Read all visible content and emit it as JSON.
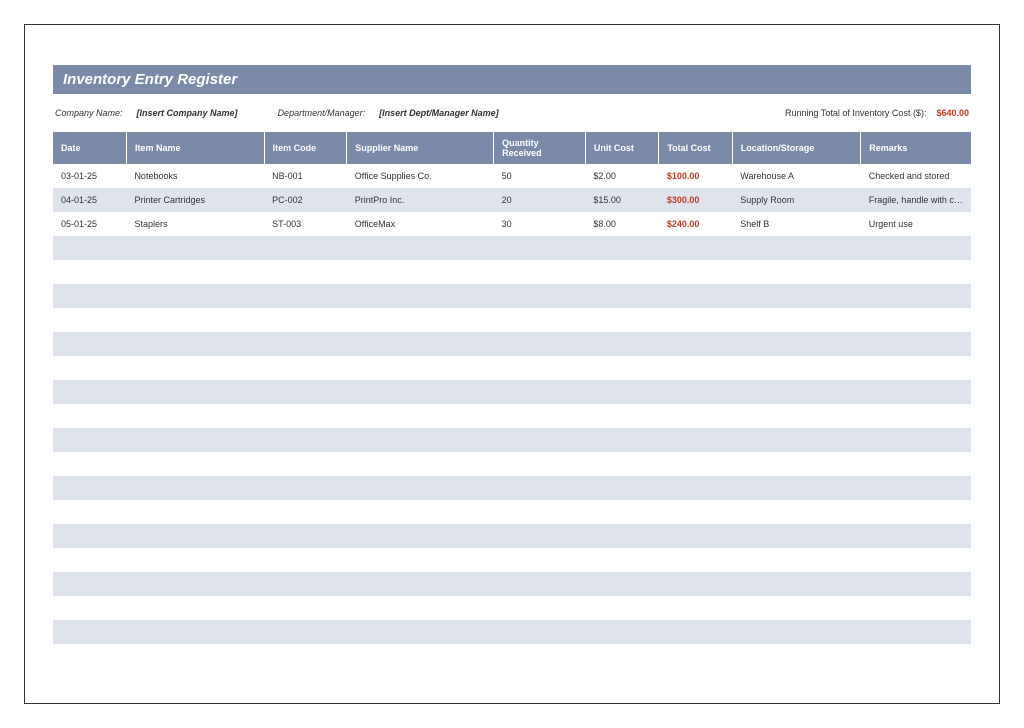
{
  "title": "Inventory Entry Register",
  "info": {
    "company_label": "Company Name:",
    "company_value": "[Insert Company Name]",
    "dept_label": "Department/Manager:",
    "dept_value": "[Insert Dept/Manager Name]",
    "running_label": "Running Total of Inventory Cost ($):",
    "running_value": "$640.00"
  },
  "headers": {
    "date": "Date",
    "item": "Item Name",
    "code": "Item Code",
    "supplier": "Supplier Name",
    "qty": "Quantity Received",
    "unit": "Unit Cost",
    "total": "Total Cost",
    "loc": "Location/Storage",
    "remarks": "Remarks"
  },
  "rows": [
    {
      "date": "03-01-25",
      "item": "Notebooks",
      "code": "NB-001",
      "supplier": "Office Supplies Co.",
      "qty": "50",
      "unit": "$2.00",
      "total": "$100.00",
      "loc": "Warehouse A",
      "remarks": "Checked and stored"
    },
    {
      "date": "04-01-25",
      "item": "Printer Cartridges",
      "code": "PC-002",
      "supplier": "PrintPro Inc.",
      "qty": "20",
      "unit": "$15.00",
      "total": "$300.00",
      "loc": "Supply Room",
      "remarks": "Fragile, handle with care"
    },
    {
      "date": "05-01-25",
      "item": "Staplers",
      "code": "ST-003",
      "supplier": "OfficeMax",
      "qty": "30",
      "unit": "$8.00",
      "total": "$240.00",
      "loc": "Shelf B",
      "remarks": "Urgent use"
    }
  ],
  "empty_rows": 18
}
